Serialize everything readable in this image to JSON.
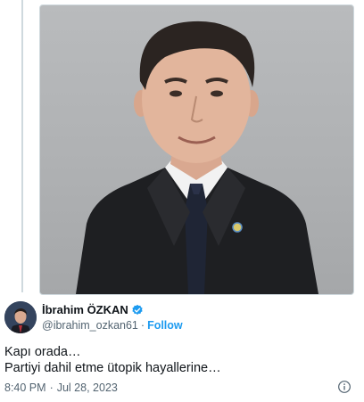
{
  "tweet": {
    "author": {
      "name": "İbrahim ÖZKAN",
      "handle": "@ibrahim_ozkan61",
      "verified_icon": "verified-badge-icon",
      "follow_label": "Follow",
      "separator": "·"
    },
    "text_lines": [
      "Kapı orada…",
      "Partiyi dahil etme ütopik hayallerine…"
    ],
    "time": "8:40 PM",
    "date_separator": "·",
    "date": "Jul 28, 2023",
    "info_icon": "info-icon"
  },
  "colors": {
    "accent": "#1d9bf0",
    "secondary_text": "#536471",
    "primary_text": "#0f1419",
    "border": "#cfd9de"
  }
}
